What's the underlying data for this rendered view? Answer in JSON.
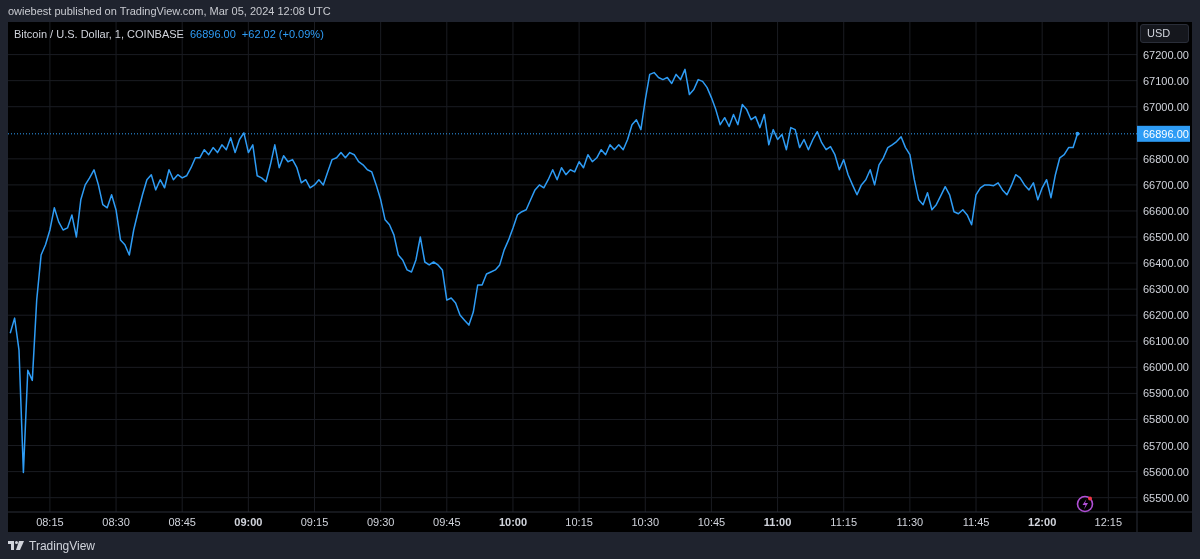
{
  "header": {
    "text": "owiebest published on TradingView.com, Mar 05, 2024 12:08 UTC"
  },
  "chart": {
    "legend": {
      "symbol": "Bitcoin / U.S. Dollar, 1, COINBASE",
      "price": "66896.00",
      "change": "+62.02 (+0.09%)"
    },
    "currency_button": "USD",
    "chart_data": {
      "type": "line",
      "categories": [
        null,
        null,
        null,
        null,
        null,
        null,
        null,
        null,
        null,
        "08:15",
        null,
        null,
        null,
        null,
        null,
        null,
        null,
        null,
        null,
        null,
        null,
        null,
        null,
        null,
        "08:30",
        null,
        null,
        null,
        null,
        null,
        null,
        null,
        null,
        null,
        null,
        null,
        null,
        null,
        null,
        "08:45",
        null,
        null,
        null,
        null,
        null,
        null,
        null,
        null,
        null,
        null,
        null,
        null,
        null,
        null,
        "09:00",
        null,
        null,
        null,
        null,
        null,
        null,
        null,
        null,
        null,
        null,
        null,
        null,
        null,
        null,
        "09:15",
        null,
        null,
        null,
        null,
        null,
        null,
        null,
        null,
        null,
        null,
        null,
        null,
        null,
        null,
        "09:30",
        null,
        null,
        null,
        null,
        null,
        null,
        null,
        null,
        null,
        null,
        null,
        null,
        null,
        null,
        "09:45",
        null,
        null,
        null,
        null,
        null,
        null,
        null,
        null,
        null,
        null,
        null,
        null,
        null,
        null,
        "10:00",
        null,
        null,
        null,
        null,
        null,
        null,
        null,
        null,
        null,
        null,
        null,
        null,
        null,
        null,
        "10:15",
        null,
        null,
        null,
        null,
        null,
        null,
        null,
        null,
        null,
        null,
        null,
        null,
        null,
        null,
        "10:30",
        null,
        null,
        null,
        null,
        null,
        null,
        null,
        null,
        null,
        null,
        null,
        null,
        null,
        null,
        "10:45",
        null,
        null,
        null,
        null,
        null,
        null,
        null,
        null,
        null,
        null,
        null,
        null,
        null,
        null,
        "11:00",
        null,
        null,
        null,
        null,
        null,
        null,
        null,
        null,
        null,
        null,
        null,
        null,
        null,
        null,
        "11:15",
        null,
        null,
        null,
        null,
        null,
        null,
        null,
        null,
        null,
        null,
        null,
        null,
        null,
        null,
        "11:30",
        null,
        null,
        null,
        null,
        null,
        null,
        null,
        null,
        null,
        null,
        null,
        null,
        null,
        null,
        "11:45",
        null,
        null,
        null,
        null,
        null,
        null,
        null,
        null,
        null,
        null,
        null,
        null,
        null,
        null,
        "12:00",
        null,
        null,
        null,
        null,
        null,
        null,
        null,
        null,
        null,
        null,
        null,
        null,
        null,
        null,
        "12:15",
        null,
        null,
        null,
        null,
        null,
        null
      ],
      "series": [
        {
          "color": "#2e9cf5",
          "values": [
            66131,
            66189,
            66066,
            65597,
            65989,
            65950,
            66258,
            66431,
            66470,
            66527,
            66612,
            66558,
            66527,
            66535,
            66585,
            66500,
            66643,
            66700,
            66727,
            66758,
            66700,
            66624,
            66612,
            66662,
            66605,
            66489,
            66470,
            66431,
            66527,
            66597,
            66662,
            66720,
            66739,
            66681,
            66720,
            66689,
            66758,
            66720,
            66739,
            66727,
            66735,
            66766,
            66804,
            66804,
            66835,
            66816,
            66843,
            66824,
            66854,
            66835,
            66881,
            66824,
            66874,
            66900,
            66824,
            66854,
            66735,
            66727,
            66712,
            66777,
            66854,
            66766,
            66812,
            66789,
            66797,
            66766,
            66708,
            66720,
            66689,
            66700,
            66720,
            66700,
            66750,
            66797,
            66804,
            66824,
            66804,
            66824,
            66816,
            66789,
            66777,
            66758,
            66750,
            66700,
            66643,
            66566,
            66547,
            66508,
            66431,
            66412,
            66374,
            66366,
            66412,
            66500,
            66404,
            66393,
            66404,
            66393,
            66374,
            66258,
            66266,
            66247,
            66201,
            66181,
            66162,
            66212,
            66316,
            66316,
            66358,
            66366,
            66374,
            66393,
            66450,
            66489,
            66535,
            66585,
            66597,
            66605,
            66643,
            66681,
            66700,
            66689,
            66720,
            66758,
            66720,
            66766,
            66739,
            66758,
            66750,
            66789,
            66766,
            66816,
            66789,
            66804,
            66835,
            66816,
            66854,
            66835,
            66854,
            66835,
            66874,
            66931,
            66950,
            66912,
            67027,
            67124,
            67131,
            67112,
            67104,
            67112,
            67089,
            67124,
            67104,
            67143,
            67047,
            67066,
            67104,
            67097,
            67074,
            67035,
            66989,
            66931,
            66958,
            66924,
            66970,
            66931,
            67008,
            66989,
            66950,
            66962,
            66920,
            66970,
            66854,
            66912,
            66874,
            66893,
            66835,
            66920,
            66912,
            66843,
            66874,
            66835,
            66874,
            66904,
            66862,
            66835,
            66847,
            66816,
            66758,
            66797,
            66739,
            66700,
            66662,
            66700,
            66720,
            66758,
            66700,
            66777,
            66804,
            66843,
            66854,
            66866,
            66885,
            66843,
            66816,
            66720,
            66643,
            66624,
            66670,
            66605,
            66624,
            66658,
            66693,
            66662,
            66597,
            66589,
            66605,
            66585,
            66547,
            66662,
            66689,
            66700,
            66700,
            66697,
            66708,
            66681,
            66662,
            66697,
            66739,
            66727,
            66700,
            66681,
            66708,
            66643,
            66689,
            66720,
            66651,
            66739,
            66804,
            66816,
            66843,
            66843,
            66896,
            null,
            null,
            null,
            null,
            null,
            null,
            null,
            null,
            null,
            null,
            null,
            null,
            null
          ]
        }
      ],
      "ylim": [
        65445,
        67325
      ],
      "grid": true,
      "ref_lines": [
        {
          "axis": "y",
          "value": 66896,
          "label": "66896.00"
        }
      ],
      "yticks": [
        {
          "value": 65500,
          "label": "65500.00"
        },
        {
          "value": 65600,
          "label": "65600.00"
        },
        {
          "value": 65700,
          "label": "65700.00"
        },
        {
          "value": 65800,
          "label": "65800.00"
        },
        {
          "value": 65900,
          "label": "65900.00"
        },
        {
          "value": 66000,
          "label": "66000.00"
        },
        {
          "value": 66100,
          "label": "66100.00"
        },
        {
          "value": 66200,
          "label": "66200.00"
        },
        {
          "value": 66300,
          "label": "66300.00"
        },
        {
          "value": 66400,
          "label": "66400.00"
        },
        {
          "value": 66500,
          "label": "66500.00"
        },
        {
          "value": 66600,
          "label": "66600.00"
        },
        {
          "value": 66700,
          "label": "66700.00"
        },
        {
          "value": 66800,
          "label": "66800.00"
        },
        {
          "value": 67000,
          "label": "67000.00"
        },
        {
          "value": 67100,
          "label": "67100.00"
        },
        {
          "value": 67200,
          "label": "67200.00"
        }
      ]
    }
  },
  "footer": {
    "brand": "TradingView"
  }
}
